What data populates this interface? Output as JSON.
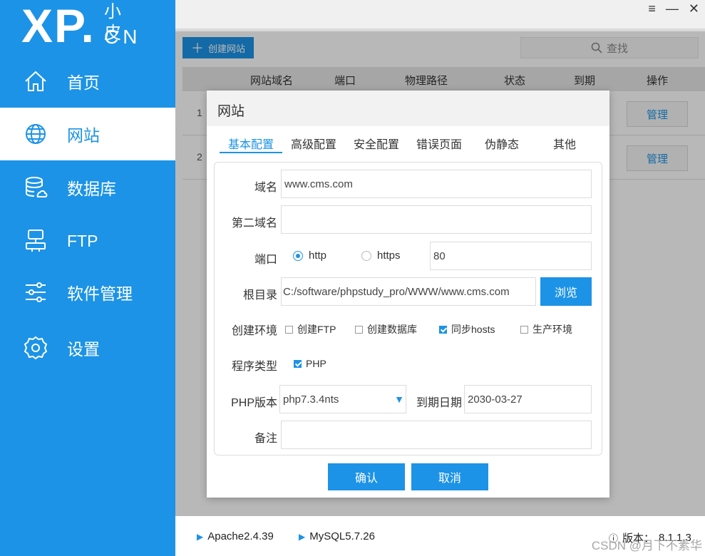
{
  "logo": {
    "brand": "XP.",
    "cn_top": "小皮",
    "cn_bottom": "CN"
  },
  "sidebar": {
    "items": [
      {
        "label": "首页",
        "icon": "home-icon"
      },
      {
        "label": "网站",
        "icon": "globe-icon",
        "active": true
      },
      {
        "label": "数据库",
        "icon": "database-icon"
      },
      {
        "label": "FTP",
        "icon": "server-icon"
      },
      {
        "label": "软件管理",
        "icon": "sliders-icon"
      },
      {
        "label": "设置",
        "icon": "gear-icon"
      }
    ]
  },
  "window": {
    "menu_icon": "≡",
    "minimize_icon": "—",
    "close_icon": "✕"
  },
  "main": {
    "create_label": "创建网站",
    "search_label": "查找",
    "columns": [
      "网站域名",
      "端口",
      "物理路径",
      "状态",
      "到期",
      "操作"
    ],
    "rows": [
      {
        "num": "1",
        "action": "管理"
      },
      {
        "num": "2",
        "action": "管理"
      }
    ]
  },
  "dialog": {
    "title": "网站",
    "tabs": [
      "基本配置",
      "高级配置",
      "安全配置",
      "错误页面",
      "伪静态",
      "其他"
    ],
    "labels": {
      "domain": "域名",
      "second_domain": "第二域名",
      "port": "端口",
      "root": "根目录",
      "env": "创建环境",
      "program": "程序类型",
      "php_version": "PHP版本",
      "expire": "到期日期",
      "note": "备注"
    },
    "values": {
      "domain": "www.cms.com",
      "second_domain": "",
      "port": "80",
      "root": "C:/software/phpstudy_pro/WWW/www.cms.com",
      "php_version": "php7.3.4nts",
      "expire": "2030-03-27",
      "note": ""
    },
    "protocols": {
      "http": "http",
      "https": "https",
      "selected": "http"
    },
    "browse_label": "浏览",
    "env_options": [
      {
        "label": "创建FTP",
        "checked": false
      },
      {
        "label": "创建数据库",
        "checked": false
      },
      {
        "label": "同步hosts",
        "checked": true
      },
      {
        "label": "生产环境",
        "checked": false
      }
    ],
    "program_options": [
      {
        "label": "PHP",
        "checked": true
      }
    ],
    "confirm_label": "确认",
    "cancel_label": "取消"
  },
  "footer": {
    "apache": "Apache2.4.39",
    "mysql": "MySQL5.7.26",
    "version_prefix": "版本：",
    "version": "8.1.1.3",
    "watermark": "CSDN @月下不素华"
  },
  "colors": {
    "accent": "#1c93e6"
  }
}
